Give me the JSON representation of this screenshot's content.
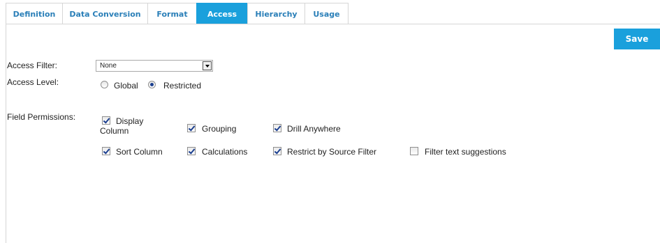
{
  "tabs": [
    {
      "label": "Definition"
    },
    {
      "label": "Data Conversion"
    },
    {
      "label": "Format"
    },
    {
      "label": "Access",
      "active": true
    },
    {
      "label": "Hierarchy"
    },
    {
      "label": "Usage"
    }
  ],
  "toolbar": {
    "save_label": "Save"
  },
  "form": {
    "access_filter": {
      "label": "Access Filter:",
      "value": "None"
    },
    "access_level": {
      "label": "Access Level:",
      "options": [
        "Global",
        "Restricted"
      ],
      "selected": "Restricted"
    },
    "field_permissions": {
      "label": "Field Permissions:",
      "items": [
        {
          "label_line1": "Display",
          "label_line2": "Column",
          "checked": true
        },
        {
          "label": "Grouping",
          "checked": true
        },
        {
          "label": "Drill Anywhere",
          "checked": true
        },
        {
          "label": "Sort Column",
          "checked": true
        },
        {
          "label": "Calculations",
          "checked": true
        },
        {
          "label": "Restrict by Source Filter",
          "checked": true
        },
        {
          "label": "Filter text suggestions",
          "checked": false
        }
      ]
    }
  },
  "colors": {
    "accent": "#1aa0dc",
    "tab_text": "#2a7fb8"
  }
}
